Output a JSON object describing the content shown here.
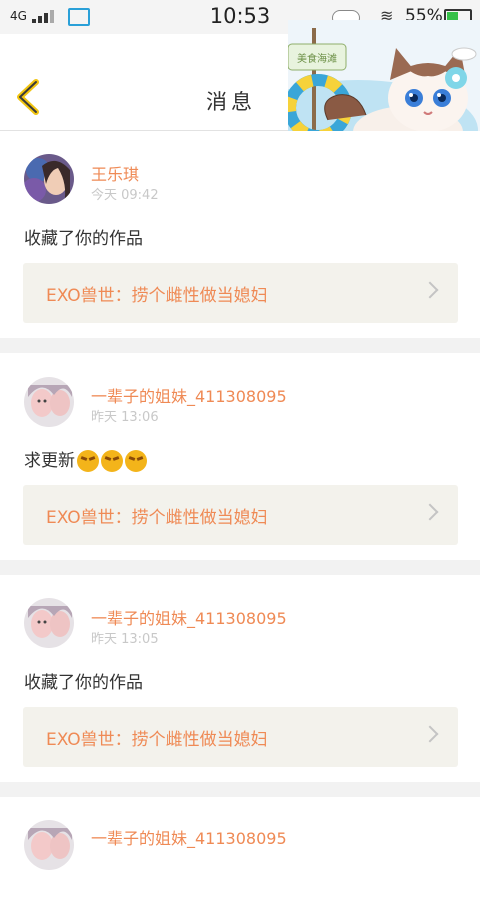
{
  "status_bar": {
    "network": "4G",
    "time": "10:53",
    "battery": "55%",
    "battery_level": 0.55
  },
  "header": {
    "title": "消息"
  },
  "messages": [
    {
      "user": "王乐琪",
      "time": "今天 09:42",
      "text": "收藏了你的作品",
      "work_title": "EXO兽世：捞个雌性做当媳妇",
      "emoji_count": 0
    },
    {
      "user": "一辈子的姐妹_411308095",
      "time": "昨天 13:06",
      "text": "求更新",
      "work_title": "EXO兽世：捞个雌性做当媳妇",
      "emoji_count": 3
    },
    {
      "user": "一辈子的姐妹_411308095",
      "time": "昨天 13:05",
      "text": "收藏了你的作品",
      "work_title": "EXO兽世：捞个雌性做当媳妇",
      "emoji_count": 0
    },
    {
      "user": "一辈子的姐妹_411308095",
      "time": "",
      "text": "",
      "work_title": "",
      "emoji_count": 0
    }
  ],
  "sticker": {
    "sign": "美食海滩"
  },
  "colors": {
    "accent": "#ef8a55",
    "back_arrow": "#f1c40f",
    "work_bg": "#f3f2ec",
    "timestamp": "#c8c8c8"
  }
}
